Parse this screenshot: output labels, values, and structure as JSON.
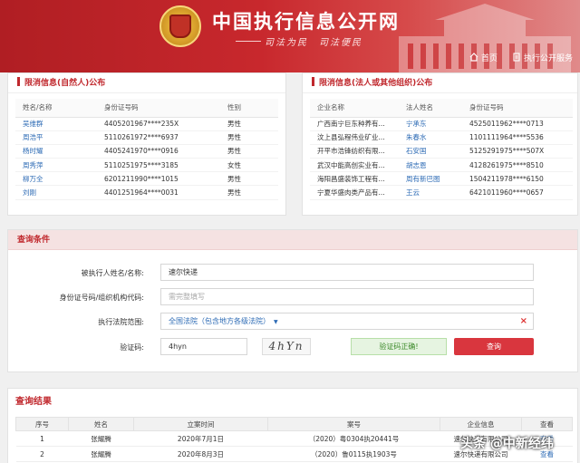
{
  "header": {
    "title": "中国执行信息公开网",
    "slogan": "司法为民　司法便民",
    "nav_home": "首页",
    "nav_public": "执行公开服务"
  },
  "left_panel": {
    "title": "限消信息(自然人)公布",
    "columns": [
      "姓名/名称",
      "身份证号码",
      "性别"
    ],
    "rows": [
      [
        "吴维群",
        "4405201967****235X",
        "男性"
      ],
      [
        "周浩平",
        "5110261972****6937",
        "男性"
      ],
      [
        "杨时耀",
        "4405241970****0916",
        "男性"
      ],
      [
        "周秀萍",
        "5110251975****3185",
        "女性"
      ],
      [
        "柳万全",
        "6201211990****1015",
        "男性"
      ],
      [
        "刘刚",
        "4401251964****0031",
        "男性"
      ]
    ]
  },
  "right_panel": {
    "title": "限消信息(法人或其他组织)公布",
    "columns": [
      "企业名称",
      "法人姓名",
      "身份证号码"
    ],
    "rows": [
      [
        "广西南宁巨东种养有...",
        "宁承东",
        "4525011962****0713"
      ],
      [
        "汶上县弘程伟业矿业...",
        "朱春水",
        "1101111964****5536"
      ],
      [
        "开平市浩锋纺织有限...",
        "石安国",
        "5125291975****507X"
      ],
      [
        "武汉中能高创实业有...",
        "胡志恩",
        "4128261975****8510"
      ],
      [
        "海阳昌盛装饰工程有...",
        "周有新巴图",
        "1504211978****6150"
      ],
      [
        "宁夏华盛肉类产品有...",
        "王云",
        "6421011960****0657"
      ]
    ]
  },
  "query": {
    "title": "查询条件",
    "name_label": "被执行人姓名/名称:",
    "name_value": "速尔快递",
    "id_label": "身份证号码/组织机构代码:",
    "id_placeholder": "需完整填写",
    "court_label": "执行法院范围:",
    "court_value": "全国法院（包含地方各级法院）",
    "captcha_label": "验证码:",
    "captcha_value": "4hyn",
    "captcha_image_text": "4hYn",
    "verify_ok": "验证码正确!",
    "search_button": "查询"
  },
  "results": {
    "title": "查询结果",
    "columns": [
      "序号",
      "姓名",
      "立案时间",
      "案号",
      "企业信息",
      "查看"
    ],
    "rows": [
      [
        "1",
        "张耀腾",
        "2020年7月1日",
        "（2020）粤0304执20441号",
        "速尔快递有限公司",
        "查看"
      ],
      [
        "2",
        "张耀腾",
        "2020年8月3日",
        "（2020）鲁0115执1903号",
        "速尔快递有限公司",
        "查看"
      ]
    ]
  },
  "watermark": "头条 @中新经纬"
}
